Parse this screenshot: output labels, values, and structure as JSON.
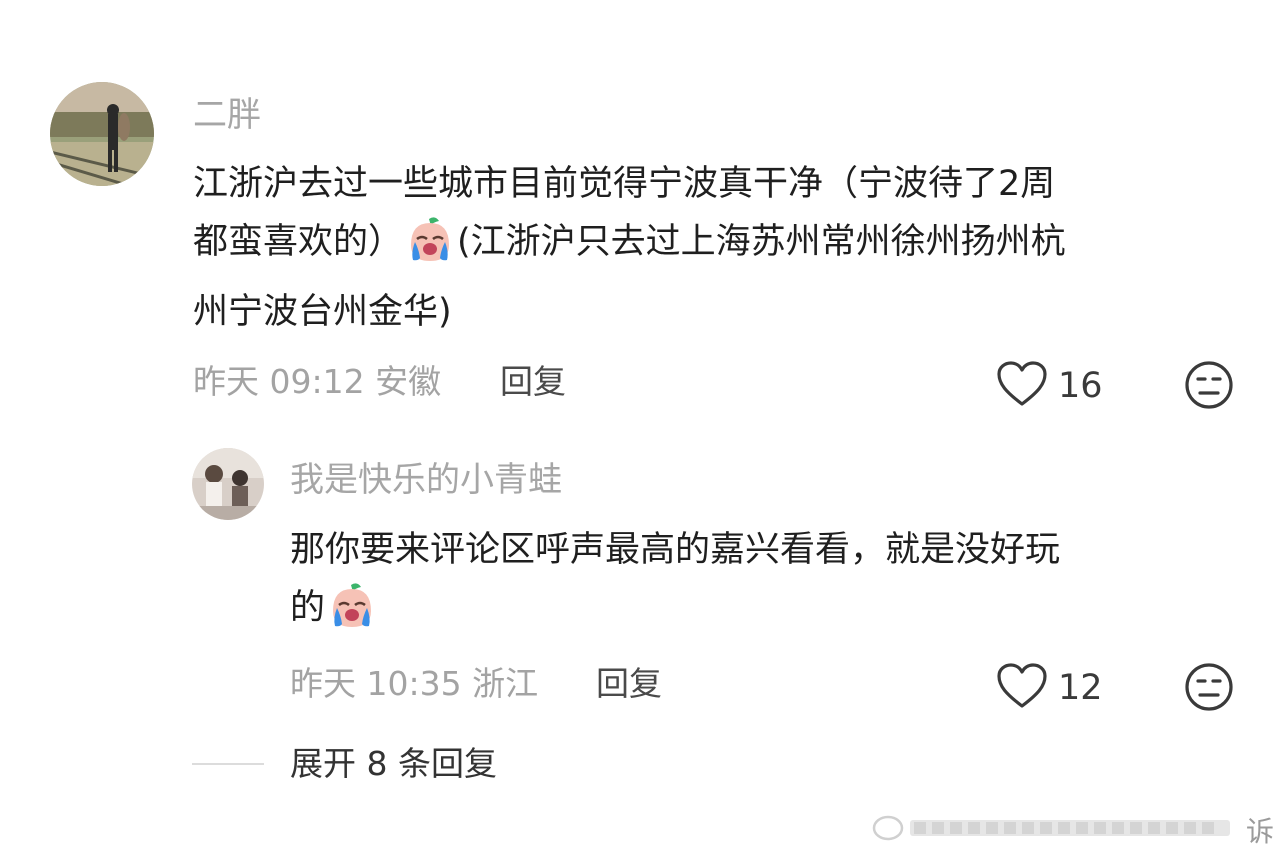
{
  "comment": {
    "username": "二胖",
    "text_lines": [
      "江浙沪去过一些城市目前觉得宁波真干净（宁波待了2周",
      "都蛮喜欢的）",
      "(江浙沪只去过上海苏州常州徐州扬州杭",
      "州宁波台州金华)"
    ],
    "emoji": "crying-face-emoji",
    "time": "昨天 09:12",
    "location": "安徽",
    "reply_label": "回复",
    "likes": "16",
    "reply": {
      "username": "我是快乐的小青蛙",
      "text_lines": [
        "那你要来评论区呼声最高的嘉兴看看，就是没好玩",
        "的"
      ],
      "emoji": "crying-face-emoji",
      "time": "昨天 10:35",
      "location": "浙江",
      "reply_label": "回复",
      "likes": "12"
    },
    "expand_label": "展开 8 条回复"
  },
  "watermark": {
    "text": "诉"
  },
  "colors": {
    "name": "#a6a6a6",
    "meta": "#a3a3a3",
    "text": "#1f1f1f",
    "emoji_face": "#f6c2b6",
    "emoji_tears": "#3a8ee6",
    "emoji_leaf": "#3cb46b"
  }
}
